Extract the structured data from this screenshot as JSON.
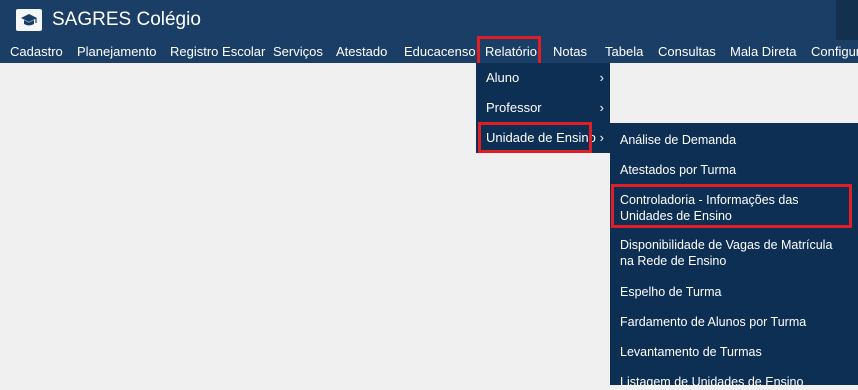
{
  "app": {
    "title": "SAGRES Colégio",
    "logo_icon": "graduation-cap-icon"
  },
  "menu": {
    "items": [
      {
        "label": "Cadastro"
      },
      {
        "label": "Planejamento"
      },
      {
        "label": "Registro Escolar"
      },
      {
        "label": "Serviços"
      },
      {
        "label": "Atestado"
      },
      {
        "label": "Educacenso"
      },
      {
        "label": "Relatório"
      },
      {
        "label": "Notas"
      },
      {
        "label": "Tabela"
      },
      {
        "label": "Consultas"
      },
      {
        "label": "Mala Direta"
      },
      {
        "label": "Configura"
      }
    ]
  },
  "relatorio_dropdown": {
    "items": [
      {
        "label": "Aluno",
        "arrow": "›"
      },
      {
        "label": "Professor",
        "arrow": "›"
      },
      {
        "label": "Unidade de Ensino",
        "arrow": "›"
      }
    ]
  },
  "unidade_submenu": {
    "items": [
      {
        "label": "Análise de Demanda"
      },
      {
        "label": "Atestados por Turma"
      },
      {
        "label": "Controladoria - Informações das Unidades de Ensino"
      },
      {
        "label": "Disponibilidade de Vagas de Matrícula na Rede de Ensino"
      },
      {
        "label": "Espelho de Turma"
      },
      {
        "label": "Fardamento de Alunos por Turma"
      },
      {
        "label": "Levantamento de Turmas"
      },
      {
        "label": "Listagem de Unidades de Ensino"
      }
    ]
  },
  "colors": {
    "header": "#1b3e66",
    "menu_dropdown": "#0d2f53",
    "highlight": "#e01e26",
    "background": "#f0f0f0"
  }
}
